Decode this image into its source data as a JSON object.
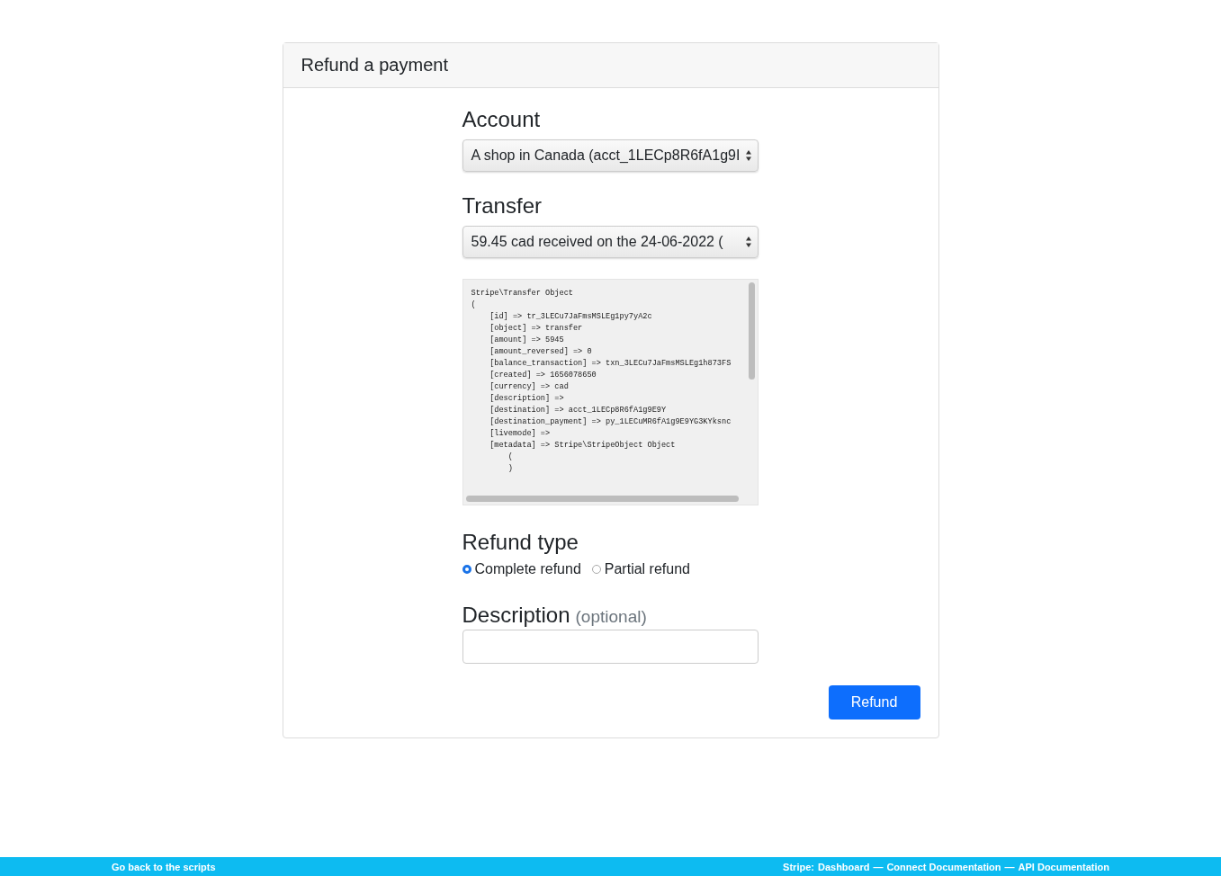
{
  "card": {
    "title": "Refund a payment"
  },
  "account": {
    "label": "Account",
    "value": "A shop in Canada (acct_1LECp8R6fA1g9I"
  },
  "transfer": {
    "label": "Transfer",
    "value": "59.45 cad received on the 24-06-2022 ("
  },
  "transfer_dump": {
    "lines": [
      "Stripe\\Transfer Object",
      "(",
      "    [id] => tr_3LECu7JaFmsMSLEg1py7yA2c",
      "    [object] => transfer",
      "    [amount] => 5945",
      "    [amount_reversed] => 0",
      "    [balance_transaction] => txn_3LECu7JaFmsMSLEg1h873FS",
      "    [created] => 1656078650",
      "    [currency] => cad",
      "    [description] =>",
      "    [destination] => acct_1LECp8R6fA1g9E9Y",
      "    [destination_payment] => py_1LECuMR6fA1g9E9YG3KYksnc",
      "    [livemode] =>",
      "    [metadata] => Stripe\\StripeObject Object",
      "        (",
      "        )"
    ]
  },
  "refund_type": {
    "label": "Refund type",
    "options": [
      {
        "label": "Complete refund",
        "selected": true
      },
      {
        "label": "Partial refund",
        "selected": false
      }
    ]
  },
  "description": {
    "label": "Description",
    "hint": "(optional)"
  },
  "submit": {
    "label": "Refund"
  },
  "footer": {
    "left_link": "Go back to the scripts",
    "right_label": "Stripe:",
    "right_links": [
      "Dashboard",
      "Connect Documentation",
      "API Documentation"
    ],
    "separators": [
      "—",
      "—"
    ]
  }
}
